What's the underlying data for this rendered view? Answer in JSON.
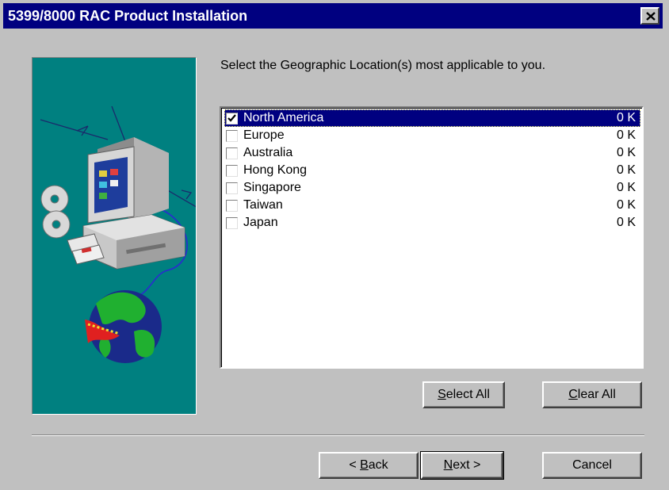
{
  "window": {
    "title": "5399/8000 RAC Product Installation"
  },
  "instruction": "Select the Geographic Location(s) most applicable to you.",
  "locations": [
    {
      "name": "North America",
      "size": "0 K",
      "checked": true,
      "selected": true
    },
    {
      "name": "Europe",
      "size": "0 K",
      "checked": false,
      "selected": false
    },
    {
      "name": "Australia",
      "size": "0 K",
      "checked": false,
      "selected": false
    },
    {
      "name": "Hong Kong",
      "size": "0 K",
      "checked": false,
      "selected": false
    },
    {
      "name": "Singapore",
      "size": "0 K",
      "checked": false,
      "selected": false
    },
    {
      "name": "Taiwan",
      "size": "0 K",
      "checked": false,
      "selected": false
    },
    {
      "name": "Japan",
      "size": "0 K",
      "checked": false,
      "selected": false
    }
  ],
  "buttons": {
    "select_all": {
      "mnemonic": "S",
      "rest": "elect All"
    },
    "clear_all": {
      "mnemonic": "C",
      "rest": "lear All"
    },
    "back": {
      "pre": "< ",
      "mnemonic": "B",
      "rest": "ack"
    },
    "next": {
      "mnemonic": "N",
      "rest": "ext >"
    },
    "cancel": "Cancel"
  },
  "icons": {
    "close": "close-x-icon",
    "checkbox": "check-mark-icon",
    "side_image": "computer-globe-illustration"
  },
  "colors": {
    "titlebar": "#000080",
    "face": "#c0c0c0",
    "side_panel": "#008080",
    "selection": "#000080"
  }
}
